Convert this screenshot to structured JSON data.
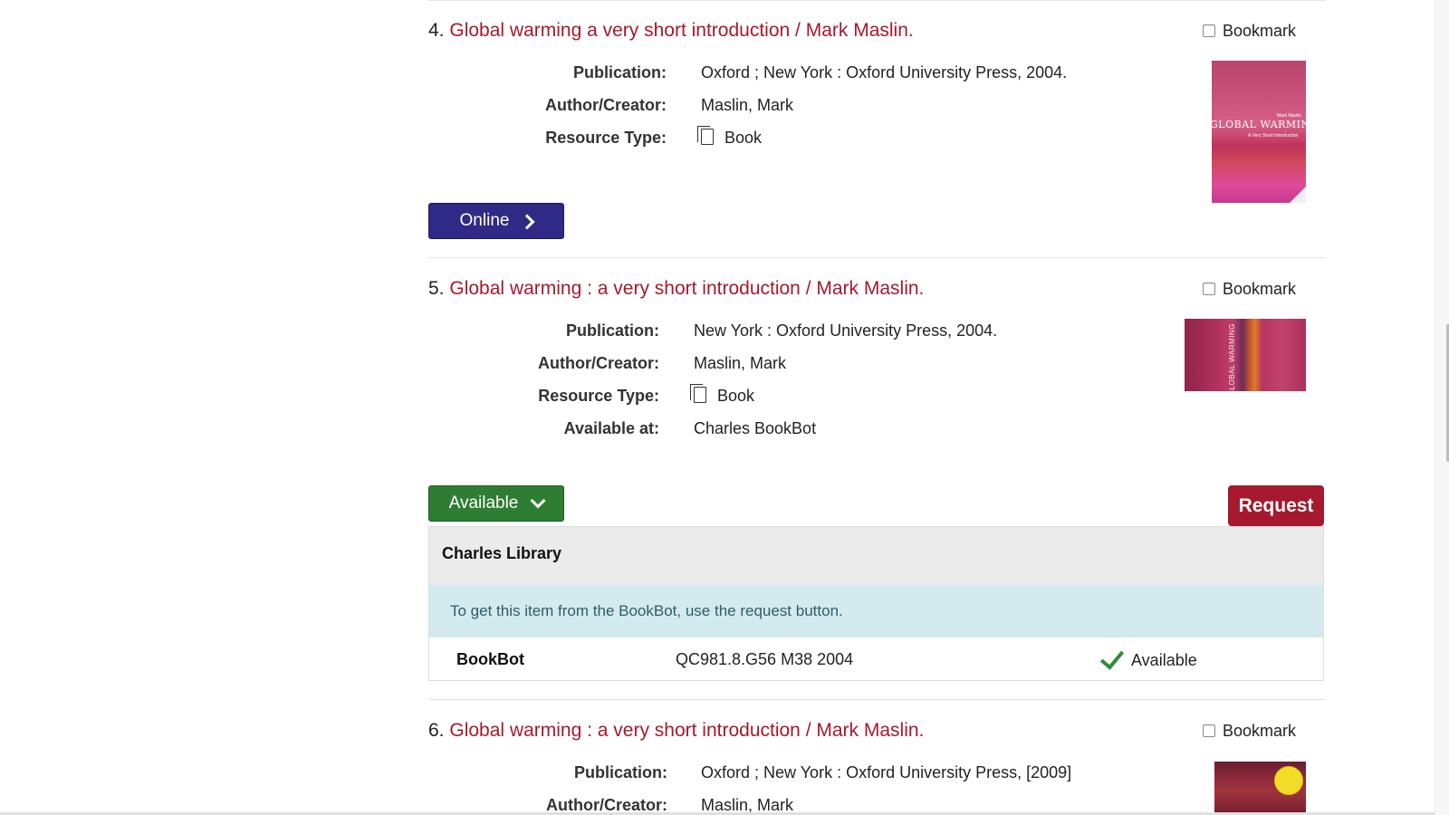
{
  "records": [
    {
      "num": "4.",
      "title": "Global warming a very short introduction / Mark Maslin.",
      "bookmark_label": "Bookmark",
      "fields": [
        {
          "label": "Publication:",
          "value": "Oxford ; New York : Oxford University Press, 2004."
        },
        {
          "label": "Author/Creator:",
          "value": "Maslin, Mark"
        },
        {
          "label": "Resource Type:",
          "value": "Book"
        }
      ],
      "cover_text": "GLOBAL WARMING",
      "action_label": "Online"
    },
    {
      "num": "5.",
      "title": "Global warming : a very short introduction / Mark Maslin.",
      "bookmark_label": "Bookmark",
      "fields": [
        {
          "label": "Publication:",
          "value": "New York : Oxford University Press, 2004."
        },
        {
          "label": "Author/Creator:",
          "value": "Maslin, Mark"
        },
        {
          "label": "Resource Type:",
          "value": "Book"
        },
        {
          "label": "Available at:",
          "value": "Charles BookBot"
        }
      ],
      "cover_text": "GLOBAL WARMING",
      "action_label": "Available",
      "request_label": "Request",
      "holdings": {
        "library": "Charles Library",
        "info": "To get this item from the BookBot, use the request button.",
        "location": "BookBot",
        "call_number": "QC981.8.G56 M38 2004",
        "status": "Available"
      }
    },
    {
      "num": "6.",
      "title": "Global warming : a very short introduction / Mark Maslin.",
      "bookmark_label": "Bookmark",
      "fields": [
        {
          "label": "Publication:",
          "value": "Oxford ; New York : Oxford University Press, [2009]"
        },
        {
          "label": "Author/Creator:",
          "value": "Maslin, Mark"
        }
      ]
    }
  ],
  "colors": {
    "title_link": "#a6192e",
    "online_button": "#2e2a85",
    "available_button": "#2e7d32",
    "request_button": "#a6192e",
    "info_background": "#d3eaef"
  },
  "icons": [
    "book-icon",
    "chevron-right-icon",
    "chevron-down-icon",
    "checkmark-icon",
    "checkbox-icon"
  ]
}
